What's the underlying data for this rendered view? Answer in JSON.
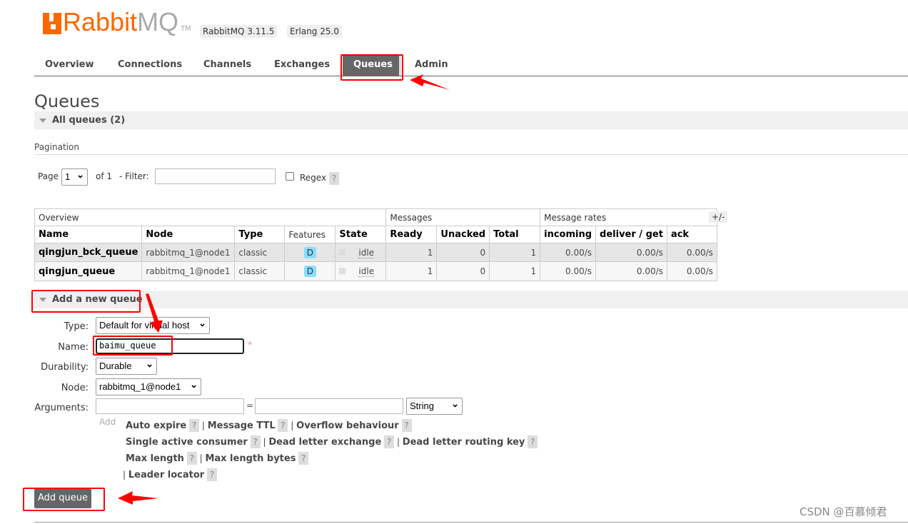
{
  "header": {
    "logo_text": "RabbitMQ",
    "logo_suffix": "TM",
    "version": "RabbitMQ 3.11.5",
    "erlang": "Erlang 25.0"
  },
  "nav": {
    "tabs": [
      {
        "label": "Overview"
      },
      {
        "label": "Connections"
      },
      {
        "label": "Channels"
      },
      {
        "label": "Exchanges"
      },
      {
        "label": "Queues",
        "active": true
      },
      {
        "label": "Admin"
      }
    ]
  },
  "page": {
    "title": "Queues",
    "all_queues": "All queues (2)",
    "pagination": "Pagination",
    "page_label": "Page",
    "page_value": "1",
    "of_label": "of 1",
    "filter_label": "- Filter:",
    "regex_label": "Regex",
    "help": "?",
    "plusminus": "+/-"
  },
  "table": {
    "groups": [
      "Overview",
      "Messages",
      "Message rates"
    ],
    "columns": [
      "Name",
      "Node",
      "Type",
      "Features",
      "State",
      "Ready",
      "Unacked",
      "Total",
      "incoming",
      "deliver / get",
      "ack"
    ],
    "rows": [
      {
        "name": "qingjun_bck_queue",
        "node": "rabbitmq_1@node1",
        "type": "classic",
        "features": "D",
        "state": "idle",
        "ready": "1",
        "unacked": "0",
        "total": "1",
        "incoming": "0.00/s",
        "deliver": "0.00/s",
        "ack": "0.00/s"
      },
      {
        "name": "qingjun_queue",
        "node": "rabbitmq_1@node1",
        "type": "classic",
        "features": "D",
        "state": "idle",
        "ready": "1",
        "unacked": "0",
        "total": "1",
        "incoming": "0.00/s",
        "deliver": "0.00/s",
        "ack": "0.00/s"
      }
    ]
  },
  "add_queue": {
    "heading": "Add a new queue",
    "type_label": "Type:",
    "type_value": "Default for virtual host",
    "name_label": "Name:",
    "name_value": "baimu_queue",
    "required": "*",
    "durability_label": "Durability:",
    "durability_value": "Durable",
    "node_label": "Node:",
    "node_value": "rabbitmq_1@node1",
    "arguments_label": "Arguments:",
    "equals": "=",
    "arg_type": "String",
    "add_label": "Add",
    "args": [
      "Auto expire",
      "Message TTL",
      "Overflow behaviour",
      "Single active consumer",
      "Dead letter exchange",
      "Dead letter routing key",
      "Max length",
      "Max length bytes",
      "Leader locator"
    ],
    "submit": "Add queue"
  },
  "watermark": "CSDN @百慕倾君",
  "colors": {
    "brand": "#ff6600",
    "annotation": "#ff0000",
    "active_tab": "#666666",
    "feature_badge": "#88ddff"
  }
}
